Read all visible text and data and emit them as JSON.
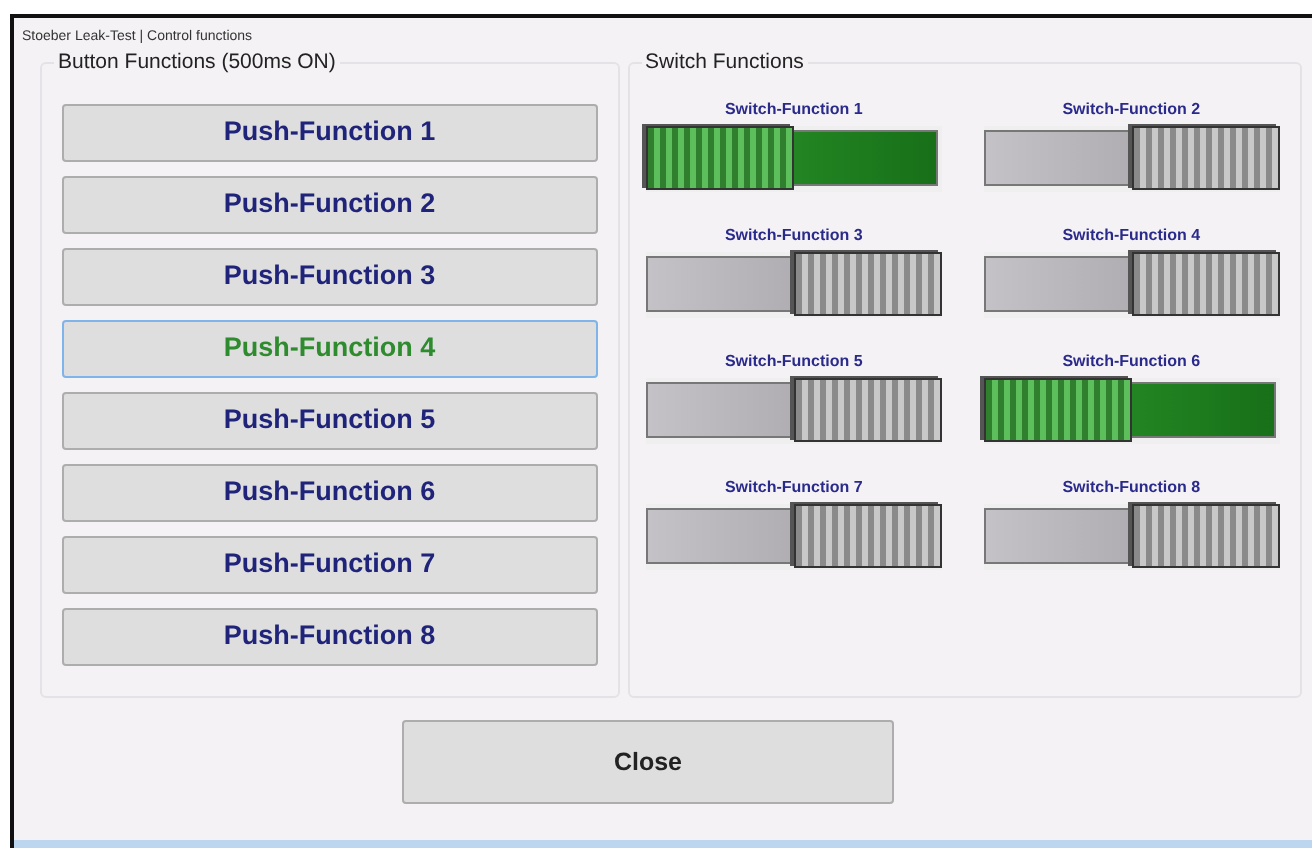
{
  "window": {
    "title": "Stoeber Leak-Test | Control functions"
  },
  "button_functions": {
    "title": "Button Functions (500ms ON)",
    "buttons": [
      {
        "label": "Push-Function 1",
        "selected": false
      },
      {
        "label": "Push-Function 2",
        "selected": false
      },
      {
        "label": "Push-Function 3",
        "selected": false
      },
      {
        "label": "Push-Function 4",
        "selected": true
      },
      {
        "label": "Push-Function 5",
        "selected": false
      },
      {
        "label": "Push-Function 6",
        "selected": false
      },
      {
        "label": "Push-Function 7",
        "selected": false
      },
      {
        "label": "Push-Function 8",
        "selected": false
      }
    ]
  },
  "switch_functions": {
    "title": "Switch Functions",
    "switches": [
      {
        "label": "Switch-Function 1",
        "on": true
      },
      {
        "label": "Switch-Function 2",
        "on": false
      },
      {
        "label": "Switch-Function 3",
        "on": false
      },
      {
        "label": "Switch-Function 4",
        "on": false
      },
      {
        "label": "Switch-Function 5",
        "on": false
      },
      {
        "label": "Switch-Function 6",
        "on": true
      },
      {
        "label": "Switch-Function 7",
        "on": false
      },
      {
        "label": "Switch-Function 8",
        "on": false
      }
    ]
  },
  "buttons": [
    "Close"
  ]
}
